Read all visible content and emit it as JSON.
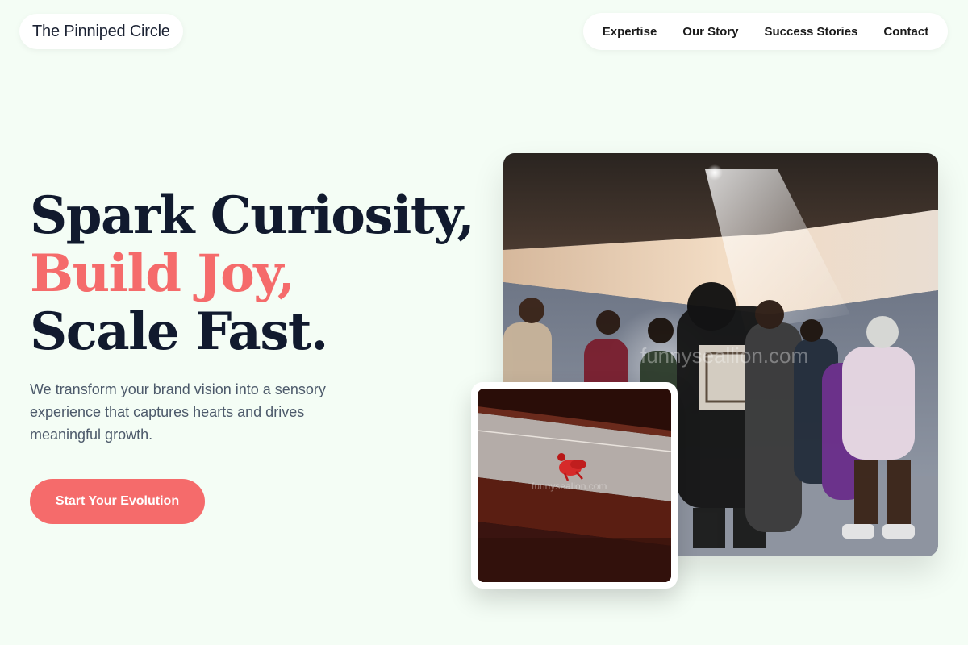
{
  "brand": {
    "name": "The Pinniped Circle"
  },
  "nav": {
    "items": [
      {
        "label": "Expertise"
      },
      {
        "label": "Our Story"
      },
      {
        "label": "Success Stories"
      },
      {
        "label": "Contact"
      }
    ]
  },
  "hero": {
    "title_line1": "Spark Curiosity,",
    "title_line2": "Build Joy,",
    "title_line3": "Scale Fast.",
    "subtitle": "We transform your brand vision into a sensory experience that captures hearts and drives meaningful growth.",
    "cta_label": "Start Your Evolution"
  },
  "images": {
    "main_watermark": "funnyseallion.com",
    "small_watermark": "funnysealion.com"
  },
  "colors": {
    "background": "#f4fdf5",
    "accent": "#f56b6b",
    "heading": "#111a2e",
    "body_text": "#4d5a6b"
  }
}
